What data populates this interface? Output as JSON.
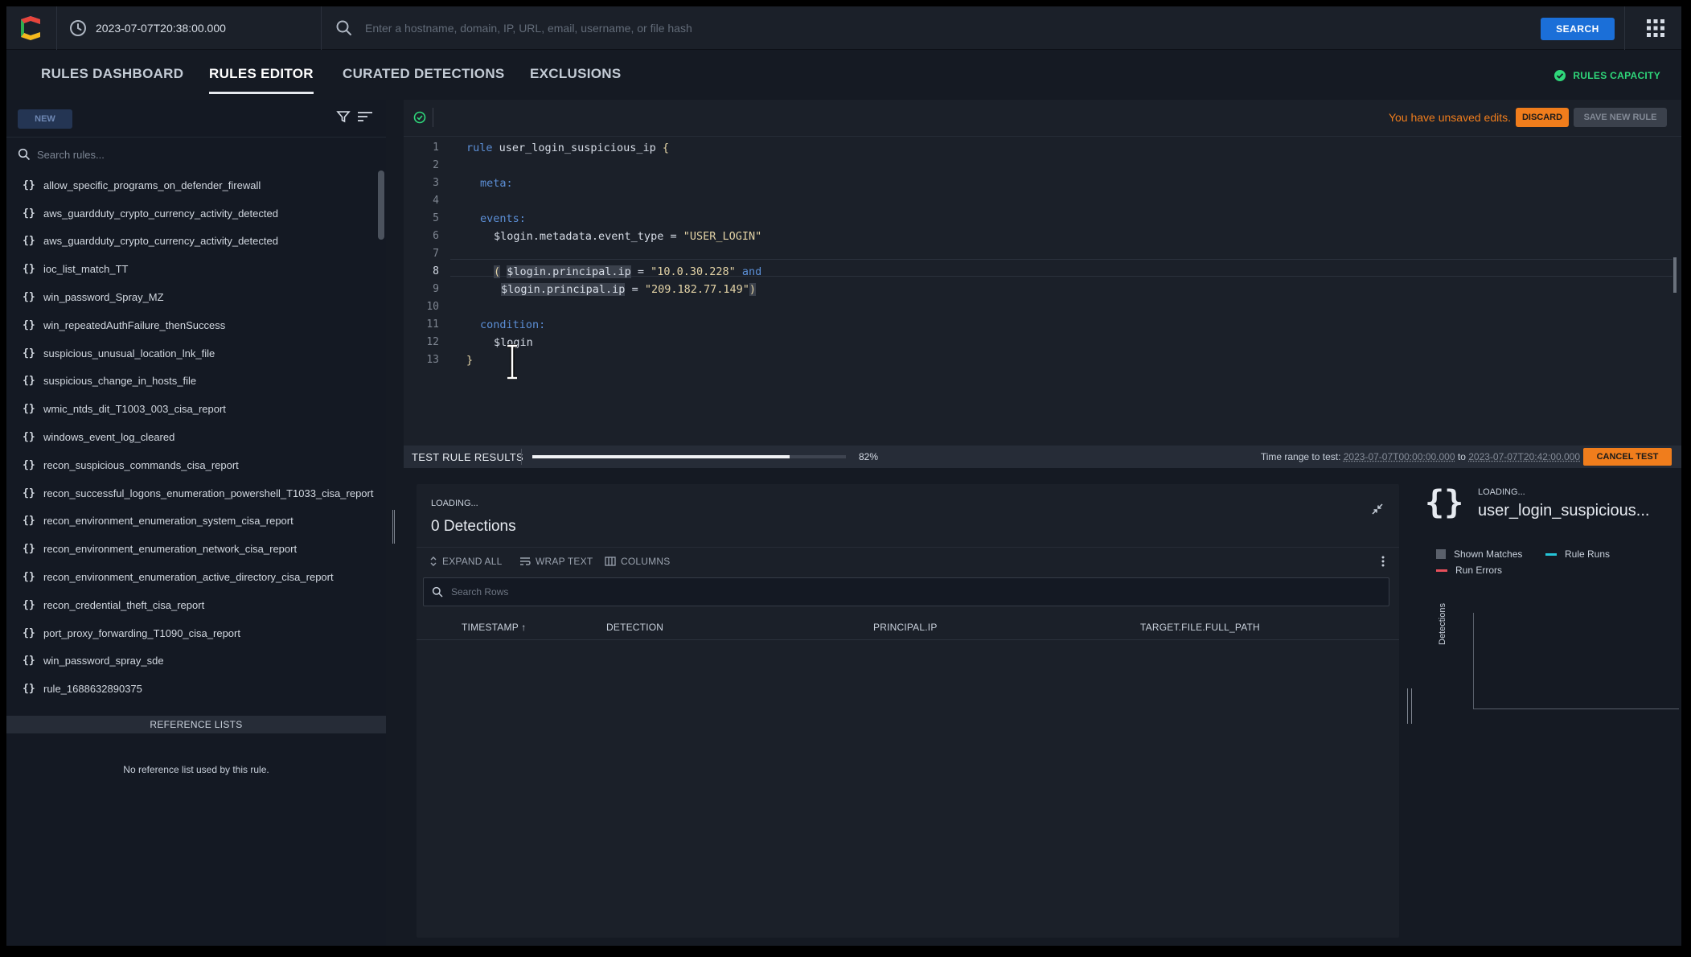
{
  "topbar": {
    "datetime": "2023-07-07T20:38:00.000",
    "search_placeholder": "Enter a hostname, domain, IP, URL, email, username, or file hash",
    "search_button": "SEARCH"
  },
  "tabs": [
    {
      "label": "RULES DASHBOARD",
      "active": false
    },
    {
      "label": "RULES EDITOR",
      "active": true
    },
    {
      "label": "CURATED DETECTIONS",
      "active": false
    },
    {
      "label": "EXCLUSIONS",
      "active": false
    }
  ],
  "rules_capacity": "RULES CAPACITY",
  "left": {
    "new_button": "NEW",
    "search_placeholder": "Search rules...",
    "rules": [
      "allow_specific_programs_on_defender_firewall",
      "aws_guardduty_crypto_currency_activity_detected",
      "aws_guardduty_crypto_currency_activity_detected",
      "ioc_list_match_TT",
      "win_password_Spray_MZ",
      "win_repeatedAuthFailure_thenSuccess",
      "suspicious_unusual_location_lnk_file",
      "suspicious_change_in_hosts_file",
      "wmic_ntds_dit_T1003_003_cisa_report",
      "windows_event_log_cleared",
      "recon_suspicious_commands_cisa_report",
      "recon_successful_logons_enumeration_powershell_T1033_cisa_report",
      "recon_environment_enumeration_system_cisa_report",
      "recon_environment_enumeration_network_cisa_report",
      "recon_environment_enumeration_active_directory_cisa_report",
      "recon_credential_theft_cisa_report",
      "port_proxy_forwarding_T1090_cisa_report",
      "win_password_spray_sde",
      "rule_1688632890375"
    ],
    "reference_lists_header": "REFERENCE LISTS",
    "reference_lists_empty": "No reference list used by this rule."
  },
  "editor": {
    "unsaved_message": "You have unsaved edits.",
    "discard_button": "DISCARD",
    "save_button": "SAVE NEW RULE",
    "line_numbers": [
      "1",
      "2",
      "3",
      "4",
      "5",
      "6",
      "7",
      "8",
      "9",
      "10",
      "11",
      "12",
      "13"
    ],
    "code": {
      "l1_kw": "rule",
      "l1_name": " user_login_suspicious_ip ",
      "l1_brace": "{",
      "l3": "meta:",
      "l5": "events:",
      "l6_var": "$login.metadata.event_type",
      "l6_op": " = ",
      "l6_str": "\"USER_LOGIN\"",
      "l8_paren": "(",
      "l8_var": "$login.principal.ip",
      "l8_op": " = ",
      "l8_str": "\"10.0.30.228\"",
      "l8_and": " and",
      "l9_var": "$login.principal.ip",
      "l9_op": " = ",
      "l9_str": "\"209.182.77.149\"",
      "l9_paren": ")",
      "l11": "condition:",
      "l12": "$login",
      "l13": "}"
    }
  },
  "test": {
    "label": "TEST RULE RESULTS",
    "progress_percent": 82,
    "progress_label": "82%",
    "time_range_label": "Time range to test: ",
    "time_from": "2023-07-07T00:00:00.000",
    "time_to_word": " to ",
    "time_to": "2023-07-07T20:42:00.000",
    "cancel_button": "CANCEL TEST"
  },
  "detections": {
    "loading": "LOADING...",
    "count_label": "0 Detections",
    "expand_all": "EXPAND ALL",
    "wrap_text": "WRAP TEXT",
    "columns": "COLUMNS",
    "search_placeholder": "Search Rows",
    "headers": [
      "TIMESTAMP",
      "DETECTION",
      "PRINCIPAL.IP",
      "TARGET.FILE.FULL_PATH"
    ],
    "sort_arrow": "↑"
  },
  "side": {
    "braces": "{}",
    "loading": "LOADING...",
    "rule_name": "user_login_suspicious...",
    "legend": [
      {
        "label": "Shown Matches",
        "color": "#5a606b"
      },
      {
        "label": "Rule Runs",
        "color": "#25c5d8"
      },
      {
        "label": "Run Errors",
        "color": "#e8505b"
      }
    ],
    "y_label": "Detections"
  }
}
